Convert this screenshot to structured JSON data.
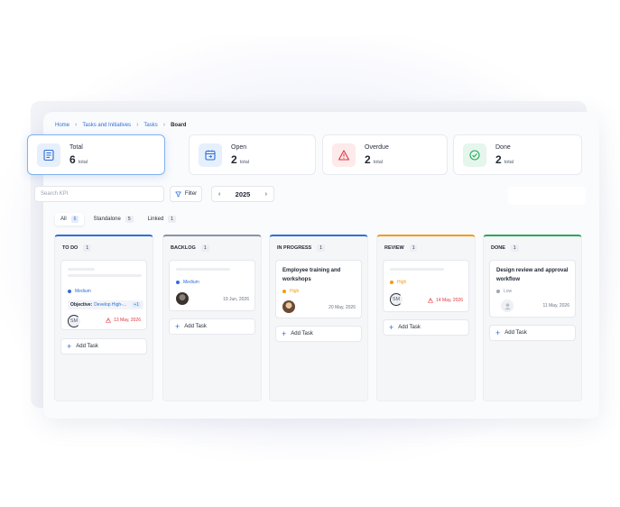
{
  "breadcrumb": {
    "items": [
      "Home",
      "Tasks and Initiatives",
      "Tasks"
    ],
    "current": "Board"
  },
  "stats": [
    {
      "label": "Total",
      "value": "6",
      "unit": "total",
      "icon": "list-icon",
      "color": "#2f6fd6"
    },
    {
      "label": "Open",
      "value": "2",
      "unit": "total",
      "icon": "calendar-icon",
      "color": "#2f6fd6"
    },
    {
      "label": "Overdue",
      "value": "2",
      "unit": "total",
      "icon": "warning-icon",
      "color": "#e0363c"
    },
    {
      "label": "Done",
      "value": "2",
      "unit": "total",
      "icon": "check-circle-icon",
      "color": "#27a85a"
    }
  ],
  "toolbar": {
    "search_placeholder": "Search KPI",
    "filter_label": "Filter",
    "year": "2025",
    "prev_icon": "chevron-left-icon",
    "next_icon": "chevron-right-icon"
  },
  "tabs": [
    {
      "label": "All",
      "count": "6"
    },
    {
      "label": "Standalone",
      "count": "5"
    },
    {
      "label": "Linked",
      "count": "1"
    }
  ],
  "columns": [
    {
      "title": "TO DO",
      "count": "1",
      "color": "#2f6fd6",
      "task": {
        "priority": "Medium",
        "priority_color": "#2f6fd6",
        "objective_label": "Objective:",
        "objective_value": "Develop High-...",
        "objective_more": "+1",
        "avatar": "SM",
        "due": "13 May, 2026"
      }
    },
    {
      "title": "BACKLOG",
      "count": "1",
      "color": "#8a92a6",
      "task": {
        "priority": "Medium",
        "priority_color": "#2f6fd6",
        "date": "19 Jun, 2026"
      }
    },
    {
      "title": "IN PROGRESS",
      "count": "1",
      "color": "#2f6fd6",
      "task": {
        "title": "Employee training and workshops",
        "priority": "High",
        "priority_color": "#f39c12",
        "date": "20 May, 2026"
      }
    },
    {
      "title": "REVIEW",
      "count": "1",
      "color": "#f39c12",
      "task": {
        "priority": "High",
        "priority_color": "#f39c12",
        "avatar": "SM",
        "due": "14 May, 2026"
      }
    },
    {
      "title": "DONE",
      "count": "1",
      "color": "#27a85a",
      "task": {
        "title": "Design review and approval workflow",
        "priority": "Low",
        "priority_color": "#a0a6b4",
        "date": "11 May, 2026"
      }
    }
  ],
  "add_task_label": "Add Task"
}
